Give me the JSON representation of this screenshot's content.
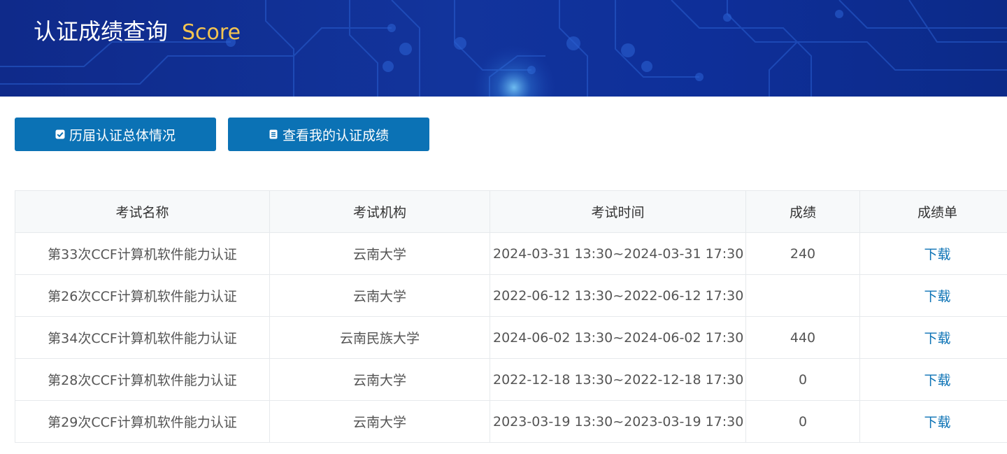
{
  "header": {
    "title": "认证成绩查询",
    "subtitle": "Score",
    "subtitle_color": "#f3c451"
  },
  "buttons": {
    "history_label": "历届认证总体情况",
    "history_icon": "checkbox-icon",
    "mine_label": "查看我的认证成绩",
    "mine_icon": "document-icon",
    "color": "#0b72b5"
  },
  "table": {
    "columns": [
      "考试名称",
      "考试机构",
      "考试时间",
      "成绩",
      "成绩单"
    ],
    "rows": [
      {
        "name": "第33次CCF计算机软件能力认证",
        "org": "云南大学",
        "time": "2024-03-31 13:30~2024-03-31 17:30",
        "score": "240",
        "report": "下载"
      },
      {
        "name": "第26次CCF计算机软件能力认证",
        "org": "云南大学",
        "time": "2022-06-12 13:30~2022-06-12 17:30",
        "score": "",
        "report": "下载"
      },
      {
        "name": "第34次CCF计算机软件能力认证",
        "org": "云南民族大学",
        "time": "2024-06-02 13:30~2024-06-02 17:30",
        "score": "440",
        "report": "下载"
      },
      {
        "name": "第28次CCF计算机软件能力认证",
        "org": "云南大学",
        "time": "2022-12-18 13:30~2022-12-18 17:30",
        "score": "0",
        "report": "下载"
      },
      {
        "name": "第29次CCF计算机软件能力认证",
        "org": "云南大学",
        "time": "2023-03-19 13:30~2023-03-19 17:30",
        "score": "0",
        "report": "下载"
      }
    ]
  }
}
